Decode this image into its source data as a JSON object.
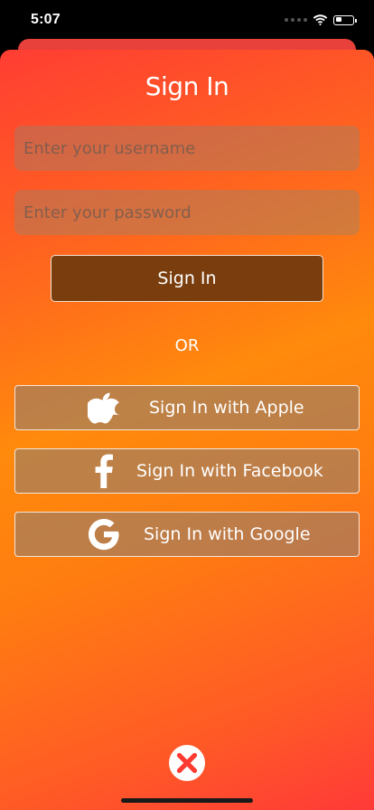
{
  "status_bar": {
    "time": "5:07"
  },
  "signin": {
    "title": "Sign In",
    "username_placeholder": "Enter your username",
    "password_placeholder": "Enter your password",
    "button_label": "Sign In",
    "or_label": "OR"
  },
  "social": {
    "apple_label": "Sign In with Apple",
    "facebook_label": "Sign In with Facebook",
    "google_label": "Sign In with Google"
  },
  "icons": {
    "apple": "apple-icon",
    "facebook": "facebook-icon",
    "google": "google-icon",
    "close": "close-icon"
  },
  "colors": {
    "gradient_top": "#ff3d33",
    "gradient_mid": "#ff8a0c",
    "signin_button": "#7a3e0e",
    "close_icon": "#ff3b30"
  }
}
